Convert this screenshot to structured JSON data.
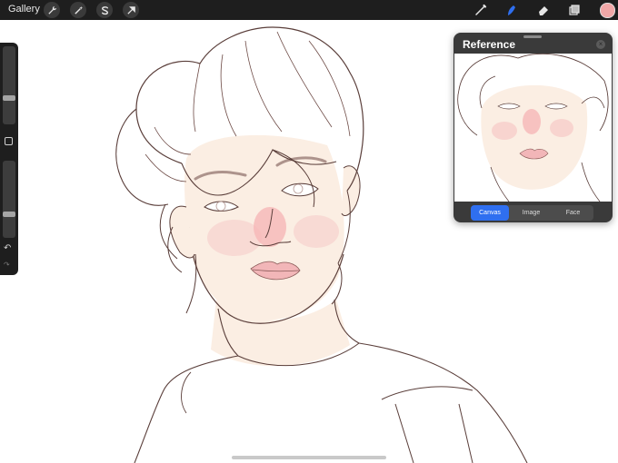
{
  "topbar": {
    "gallery_label": "Gallery",
    "left_tools": [
      {
        "name": "actions",
        "icon": "wrench-icon"
      },
      {
        "name": "adjustments",
        "icon": "magic-wand-icon"
      },
      {
        "name": "selection",
        "icon": "selection-s-icon"
      },
      {
        "name": "transform",
        "icon": "arrow-cursor-icon"
      }
    ],
    "right_tools": [
      {
        "name": "brush",
        "icon": "brush-icon"
      },
      {
        "name": "smudge",
        "icon": "smudge-icon",
        "active": true
      },
      {
        "name": "eraser",
        "icon": "eraser-icon"
      },
      {
        "name": "layers",
        "icon": "layers-icon"
      }
    ],
    "current_color": "#f1a7a7"
  },
  "sidebar": {
    "brush_size_level": 0.67,
    "opacity_level": 0.71
  },
  "reference": {
    "title": "Reference",
    "tabs": [
      {
        "label": "Canvas",
        "active": true
      },
      {
        "label": "Image",
        "active": false
      },
      {
        "label": "Face",
        "active": false
      }
    ]
  },
  "colors": {
    "toolbar_bg": "#1e1e1e",
    "accent_blue": "#2f6ff0",
    "line_art": "#5a3e3a",
    "skin_tone": "#fbeee3",
    "blush": "#f4aeb0"
  }
}
